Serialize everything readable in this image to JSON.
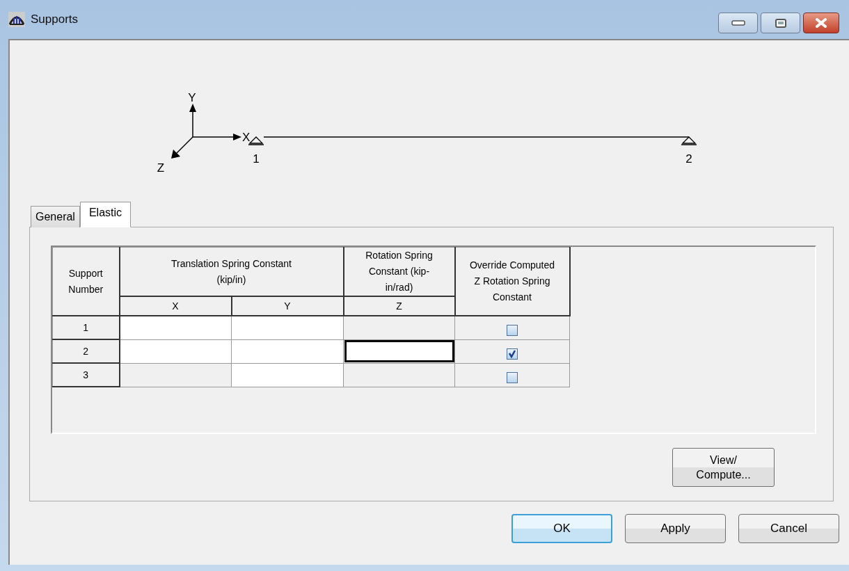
{
  "window": {
    "title": "Supports"
  },
  "diagram": {
    "axes": [
      {
        "kind": "y",
        "label": "Y"
      },
      {
        "kind": "x",
        "label": "X"
      },
      {
        "kind": "z",
        "label": "Z"
      }
    ],
    "supports": [
      "1",
      "2"
    ]
  },
  "tabs": [
    {
      "label": "General",
      "selected": false
    },
    {
      "label": "Elastic",
      "selected": true
    }
  ],
  "grid": {
    "headers": [
      "Support Number",
      "Translation Spring Constant (kip/in)",
      "Rotation Spring Constant (kip-in/rad)",
      "Override Computed Z Rotation Spring Constant"
    ],
    "subheaders": [
      "X",
      "Y",
      "Z"
    ],
    "rows": [
      {
        "number": "1",
        "cells": [
          {
            "editable": true,
            "focused": false
          },
          {
            "editable": true,
            "focused": false
          },
          {
            "editable": false,
            "focused": false
          }
        ],
        "override": {
          "checked": false
        }
      },
      {
        "number": "2",
        "cells": [
          {
            "editable": true,
            "focused": false
          },
          {
            "editable": true,
            "focused": false
          },
          {
            "editable": true,
            "focused": true
          }
        ],
        "override": {
          "checked": true
        }
      },
      {
        "number": "3",
        "cells": [
          {
            "editable": false,
            "focused": false
          },
          {
            "editable": true,
            "focused": false
          },
          {
            "editable": false,
            "focused": false
          }
        ],
        "override": {
          "checked": false
        }
      }
    ]
  },
  "panel_button": "View/ Compute...",
  "buttons": [
    {
      "label": "OK",
      "default": true
    },
    {
      "label": "Apply",
      "default": false
    },
    {
      "label": "Cancel",
      "default": false
    }
  ]
}
